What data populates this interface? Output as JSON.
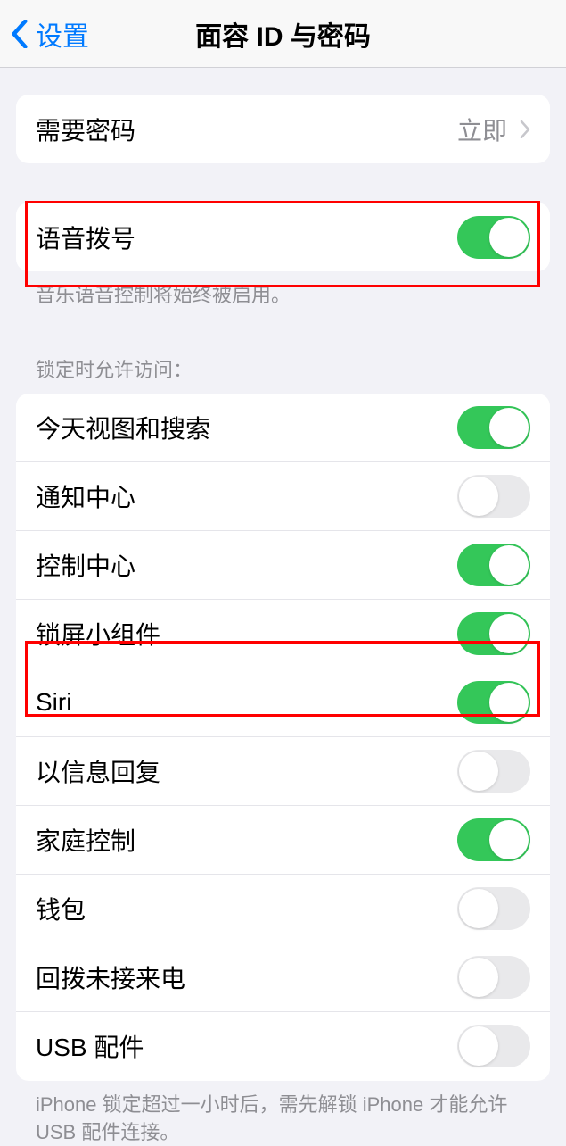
{
  "nav": {
    "back_label": "设置",
    "title": "面容 ID 与密码"
  },
  "require_passcode": {
    "label": "需要密码",
    "value": "立即"
  },
  "voice_dial": {
    "label": "语音拨号",
    "footer": "音乐语音控制将始终被启用。"
  },
  "lock_access": {
    "header": "锁定时允许访问：",
    "items": [
      {
        "label": "今天视图和搜索",
        "on": true
      },
      {
        "label": "通知中心",
        "on": false
      },
      {
        "label": "控制中心",
        "on": true
      },
      {
        "label": "锁屏小组件",
        "on": true
      },
      {
        "label": "Siri",
        "on": true
      },
      {
        "label": "以信息回复",
        "on": false
      },
      {
        "label": "家庭控制",
        "on": true
      },
      {
        "label": "钱包",
        "on": false
      },
      {
        "label": "回拨未接来电",
        "on": false
      },
      {
        "label": "USB 配件",
        "on": false
      }
    ],
    "footer": "iPhone 锁定超过一小时后，需先解锁 iPhone 才能允许 USB 配件连接。"
  }
}
